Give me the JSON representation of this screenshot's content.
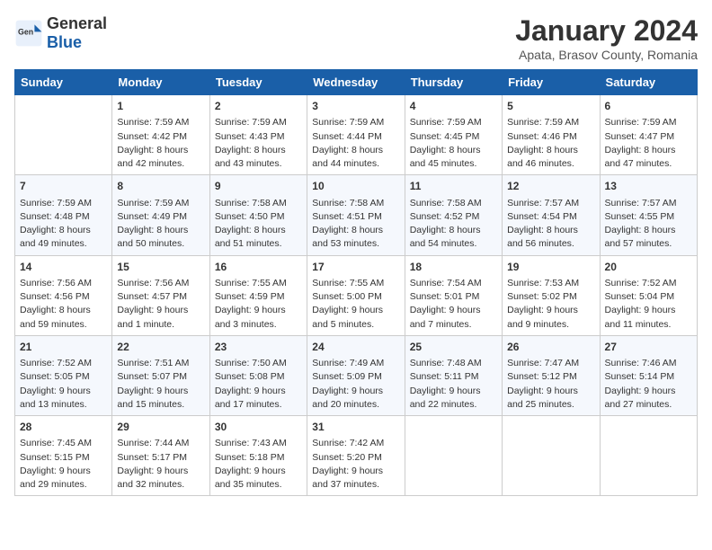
{
  "header": {
    "logo_general": "General",
    "logo_blue": "Blue",
    "month_title": "January 2024",
    "location": "Apata, Brasov County, Romania"
  },
  "days_of_week": [
    "Sunday",
    "Monday",
    "Tuesday",
    "Wednesday",
    "Thursday",
    "Friday",
    "Saturday"
  ],
  "weeks": [
    [
      {
        "day": "",
        "info": ""
      },
      {
        "day": "1",
        "info": "Sunrise: 7:59 AM\nSunset: 4:42 PM\nDaylight: 8 hours\nand 42 minutes."
      },
      {
        "day": "2",
        "info": "Sunrise: 7:59 AM\nSunset: 4:43 PM\nDaylight: 8 hours\nand 43 minutes."
      },
      {
        "day": "3",
        "info": "Sunrise: 7:59 AM\nSunset: 4:44 PM\nDaylight: 8 hours\nand 44 minutes."
      },
      {
        "day": "4",
        "info": "Sunrise: 7:59 AM\nSunset: 4:45 PM\nDaylight: 8 hours\nand 45 minutes."
      },
      {
        "day": "5",
        "info": "Sunrise: 7:59 AM\nSunset: 4:46 PM\nDaylight: 8 hours\nand 46 minutes."
      },
      {
        "day": "6",
        "info": "Sunrise: 7:59 AM\nSunset: 4:47 PM\nDaylight: 8 hours\nand 47 minutes."
      }
    ],
    [
      {
        "day": "7",
        "info": "Sunrise: 7:59 AM\nSunset: 4:48 PM\nDaylight: 8 hours\nand 49 minutes."
      },
      {
        "day": "8",
        "info": "Sunrise: 7:59 AM\nSunset: 4:49 PM\nDaylight: 8 hours\nand 50 minutes."
      },
      {
        "day": "9",
        "info": "Sunrise: 7:58 AM\nSunset: 4:50 PM\nDaylight: 8 hours\nand 51 minutes."
      },
      {
        "day": "10",
        "info": "Sunrise: 7:58 AM\nSunset: 4:51 PM\nDaylight: 8 hours\nand 53 minutes."
      },
      {
        "day": "11",
        "info": "Sunrise: 7:58 AM\nSunset: 4:52 PM\nDaylight: 8 hours\nand 54 minutes."
      },
      {
        "day": "12",
        "info": "Sunrise: 7:57 AM\nSunset: 4:54 PM\nDaylight: 8 hours\nand 56 minutes."
      },
      {
        "day": "13",
        "info": "Sunrise: 7:57 AM\nSunset: 4:55 PM\nDaylight: 8 hours\nand 57 minutes."
      }
    ],
    [
      {
        "day": "14",
        "info": "Sunrise: 7:56 AM\nSunset: 4:56 PM\nDaylight: 8 hours\nand 59 minutes."
      },
      {
        "day": "15",
        "info": "Sunrise: 7:56 AM\nSunset: 4:57 PM\nDaylight: 9 hours\nand 1 minute."
      },
      {
        "day": "16",
        "info": "Sunrise: 7:55 AM\nSunset: 4:59 PM\nDaylight: 9 hours\nand 3 minutes."
      },
      {
        "day": "17",
        "info": "Sunrise: 7:55 AM\nSunset: 5:00 PM\nDaylight: 9 hours\nand 5 minutes."
      },
      {
        "day": "18",
        "info": "Sunrise: 7:54 AM\nSunset: 5:01 PM\nDaylight: 9 hours\nand 7 minutes."
      },
      {
        "day": "19",
        "info": "Sunrise: 7:53 AM\nSunset: 5:02 PM\nDaylight: 9 hours\nand 9 minutes."
      },
      {
        "day": "20",
        "info": "Sunrise: 7:52 AM\nSunset: 5:04 PM\nDaylight: 9 hours\nand 11 minutes."
      }
    ],
    [
      {
        "day": "21",
        "info": "Sunrise: 7:52 AM\nSunset: 5:05 PM\nDaylight: 9 hours\nand 13 minutes."
      },
      {
        "day": "22",
        "info": "Sunrise: 7:51 AM\nSunset: 5:07 PM\nDaylight: 9 hours\nand 15 minutes."
      },
      {
        "day": "23",
        "info": "Sunrise: 7:50 AM\nSunset: 5:08 PM\nDaylight: 9 hours\nand 17 minutes."
      },
      {
        "day": "24",
        "info": "Sunrise: 7:49 AM\nSunset: 5:09 PM\nDaylight: 9 hours\nand 20 minutes."
      },
      {
        "day": "25",
        "info": "Sunrise: 7:48 AM\nSunset: 5:11 PM\nDaylight: 9 hours\nand 22 minutes."
      },
      {
        "day": "26",
        "info": "Sunrise: 7:47 AM\nSunset: 5:12 PM\nDaylight: 9 hours\nand 25 minutes."
      },
      {
        "day": "27",
        "info": "Sunrise: 7:46 AM\nSunset: 5:14 PM\nDaylight: 9 hours\nand 27 minutes."
      }
    ],
    [
      {
        "day": "28",
        "info": "Sunrise: 7:45 AM\nSunset: 5:15 PM\nDaylight: 9 hours\nand 29 minutes."
      },
      {
        "day": "29",
        "info": "Sunrise: 7:44 AM\nSunset: 5:17 PM\nDaylight: 9 hours\nand 32 minutes."
      },
      {
        "day": "30",
        "info": "Sunrise: 7:43 AM\nSunset: 5:18 PM\nDaylight: 9 hours\nand 35 minutes."
      },
      {
        "day": "31",
        "info": "Sunrise: 7:42 AM\nSunset: 5:20 PM\nDaylight: 9 hours\nand 37 minutes."
      },
      {
        "day": "",
        "info": ""
      },
      {
        "day": "",
        "info": ""
      },
      {
        "day": "",
        "info": ""
      }
    ]
  ]
}
